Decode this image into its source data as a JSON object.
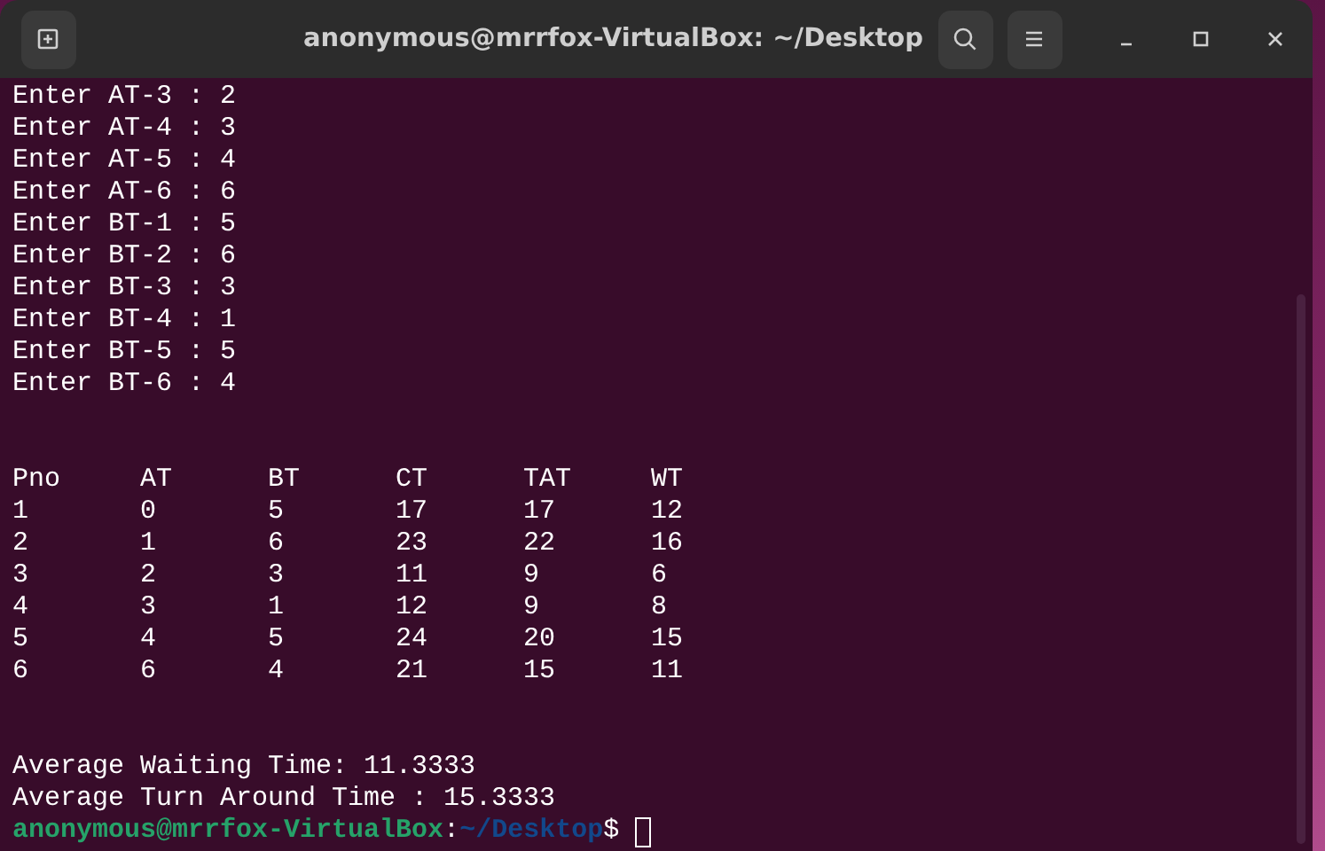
{
  "window": {
    "title": "anonymous@mrrfox-VirtualBox: ~/Desktop"
  },
  "output": {
    "input_lines": [
      "Enter AT-3 : 2",
      "Enter AT-4 : 3",
      "Enter AT-5 : 4",
      "Enter AT-6 : 6",
      "Enter BT-1 : 5",
      "Enter BT-2 : 6",
      "Enter BT-3 : 3",
      "Enter BT-4 : 1",
      "Enter BT-5 : 5",
      "Enter BT-6 : 4"
    ],
    "table": {
      "columns": [
        "Pno",
        "AT",
        "BT",
        "CT",
        "TAT",
        "WT"
      ],
      "rows": [
        [
          "1",
          "0",
          "5",
          "17",
          "17",
          "12"
        ],
        [
          "2",
          "1",
          "6",
          "23",
          "22",
          "16"
        ],
        [
          "3",
          "2",
          "3",
          "11",
          "9",
          "6"
        ],
        [
          "4",
          "3",
          "1",
          "12",
          "9",
          "8"
        ],
        [
          "5",
          "4",
          "5",
          "24",
          "20",
          "15"
        ],
        [
          "6",
          "6",
          "4",
          "21",
          "15",
          "11"
        ]
      ]
    },
    "summary_lines": [
      "Average Waiting Time: 11.3333",
      "Average Turn Around Time : 15.3333"
    ],
    "prompt": {
      "user_host": "anonymous@mrrfox-VirtualBox",
      "separator": ":",
      "path": "~/Desktop",
      "symbol": "$"
    }
  }
}
